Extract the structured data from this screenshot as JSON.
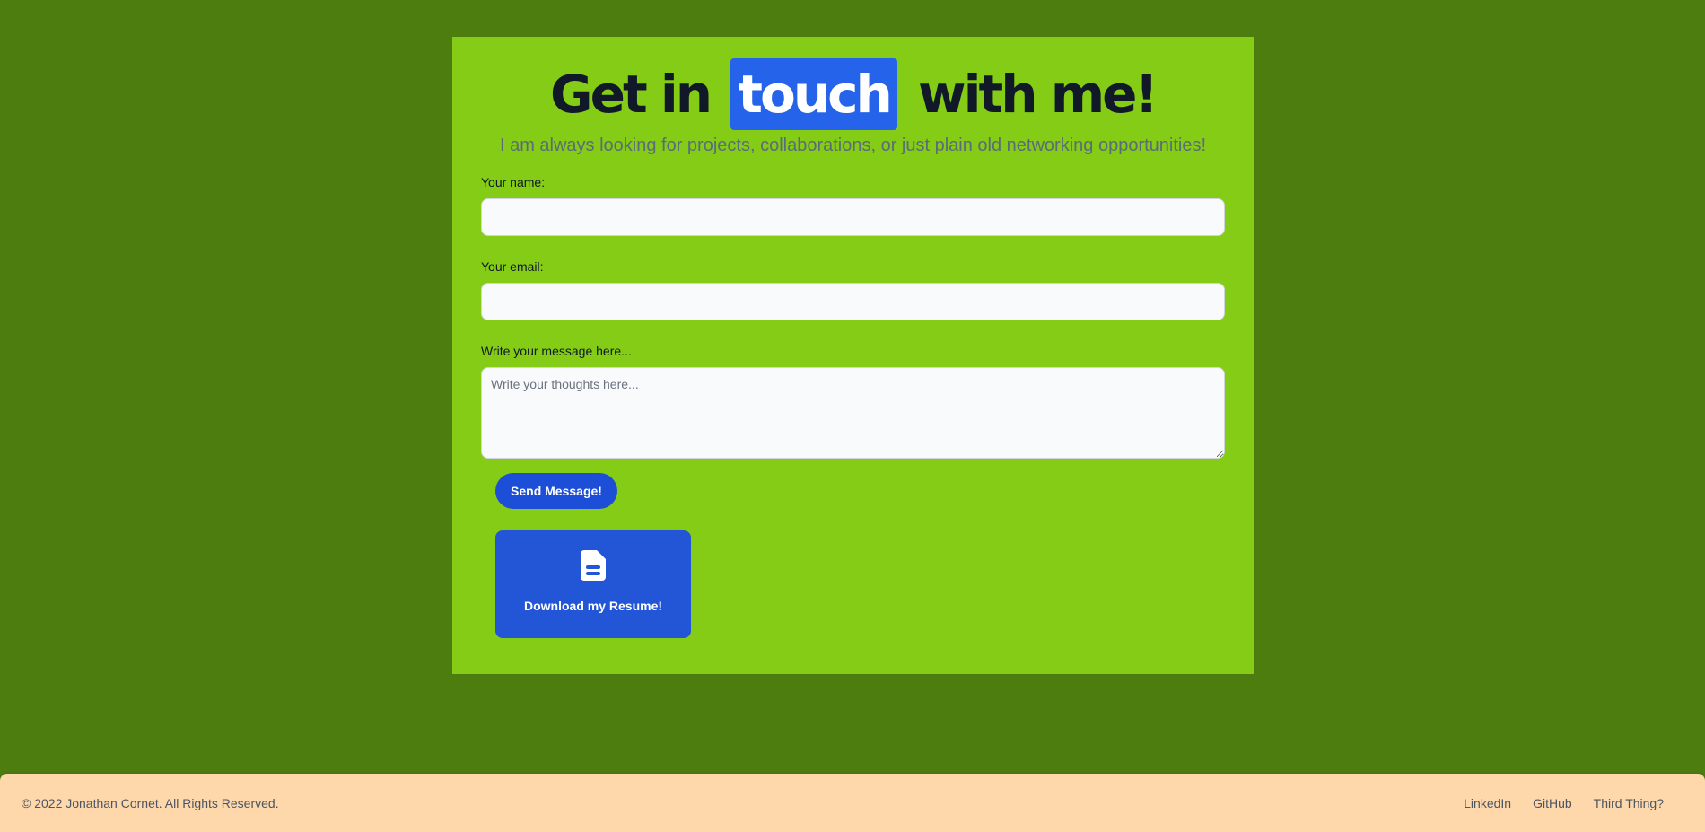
{
  "contact": {
    "heading_before": "Get in",
    "heading_highlight": "touch",
    "heading_after": "with me!",
    "subtitle": "I am always looking for projects, collaborations, or just plain old networking opportunities!",
    "name_label": "Your name:",
    "name_value": "",
    "email_label": "Your email:",
    "email_value": "",
    "message_label": "Write your message here...",
    "message_placeholder": "Write your thoughts here...",
    "send_label": "Send Message!",
    "resume_label": "Download my Resume!",
    "resume_icon": "document-icon"
  },
  "footer": {
    "copyright": "© 2022 Jonathan Cornet. All Rights Reserved.",
    "links": [
      "LinkedIn",
      "GitHub",
      "Third Thing?"
    ]
  },
  "colors": {
    "page_bg": "#4d7c0f",
    "card_bg": "#84cc16",
    "accent": "#2563eb",
    "button": "#1d4ed8",
    "footer_bg": "#fed7aa"
  }
}
